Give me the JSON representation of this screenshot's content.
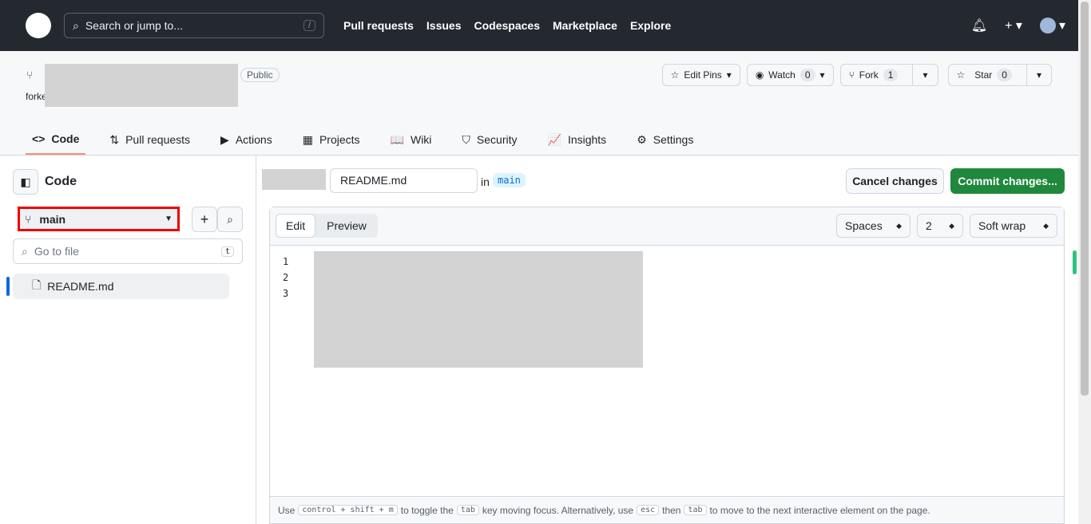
{
  "header": {
    "search_placeholder": "Search or jump to...",
    "search_key": "/",
    "nav": [
      "Pull requests",
      "Issues",
      "Codespaces",
      "Marketplace",
      "Explore"
    ]
  },
  "repo": {
    "visibility": "Public",
    "forked_prefix": "forke",
    "edit_pins": "Edit Pins",
    "watch": "Watch",
    "watch_count": "0",
    "fork": "Fork",
    "fork_count": "1",
    "star": "Star",
    "star_count": "0"
  },
  "tabs": [
    {
      "label": "Code",
      "icon": "<>"
    },
    {
      "label": "Pull requests",
      "icon": "⇅"
    },
    {
      "label": "Actions",
      "icon": "▶"
    },
    {
      "label": "Projects",
      "icon": "▦"
    },
    {
      "label": "Wiki",
      "icon": "📖"
    },
    {
      "label": "Security",
      "icon": "⛉"
    },
    {
      "label": "Insights",
      "icon": "📈"
    },
    {
      "label": "Settings",
      "icon": "⚙"
    }
  ],
  "sidebar": {
    "title": "Code",
    "branch": "main",
    "go_to_file": "Go to file",
    "shortcut": "t",
    "files": [
      "README.md"
    ]
  },
  "editor": {
    "filename": "README.md",
    "in": "in",
    "branch": "main",
    "cancel": "Cancel changes",
    "commit": "Commit changes...",
    "edit_tab": "Edit",
    "preview_tab": "Preview",
    "indent_mode": "Spaces",
    "indent_size": "2",
    "wrap": "Soft wrap",
    "line_numbers": [
      "1",
      "2",
      "3"
    ],
    "hint": {
      "use": "Use",
      "combo": "control + shift + m",
      "t1": "to toggle the",
      "tab": "tab",
      "t2": "key moving focus. Alternatively, use",
      "esc": "esc",
      "then": "then",
      "tab2": "tab",
      "t3": "to move to the next interactive element on the page."
    }
  },
  "colors": {
    "accent": "#1f883d",
    "highlight": "#ff0000"
  }
}
